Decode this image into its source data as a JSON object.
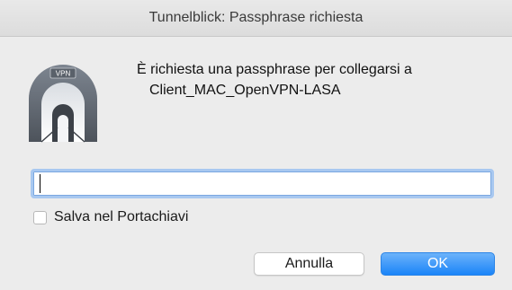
{
  "window": {
    "title": "Tunnelblick: Passphrase richiesta"
  },
  "icon": {
    "name": "tunnelblick-vpn-tunnel-icon",
    "badge_text": "VPN"
  },
  "message": {
    "line1": "È richiesta una passphrase per collegarsi a",
    "line2": "Client_MAC_OpenVPN-LASA"
  },
  "passphrase_field": {
    "value": "",
    "placeholder": ""
  },
  "save_in_keychain": {
    "label": "Salva nel Portachiavi",
    "checked": false
  },
  "buttons": {
    "cancel_label": "Annulla",
    "ok_label": "OK"
  },
  "colors": {
    "accent": "#1a84f8",
    "focus_ring": "#a8c8f0",
    "window_bg": "#ececec"
  }
}
